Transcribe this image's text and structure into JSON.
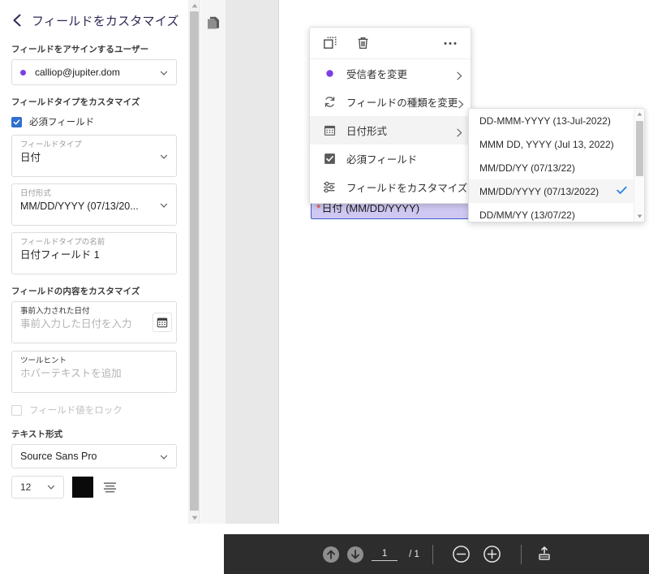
{
  "panel": {
    "title": "フィールドをカスタマイズ",
    "back_icon": "chevron-left-icon",
    "assign_label": "フィールドをアサインするユーザー",
    "assignee_email": "calliop@jupiter.dom",
    "assignee_dot_color": "#7b3fe4",
    "customize_type_label": "フィールドタイプをカスタマイズ",
    "required_checkbox_label": "必須フィールド",
    "required_checked": true,
    "field_type_caption": "フィールドタイプ",
    "field_type_value": "日付",
    "date_format_caption": "日付形式",
    "date_format_value": "MM/DD/YYYY (07/13/20...",
    "field_name_caption": "フィールドタイプの名前",
    "field_name_value": "日付フィールド 1",
    "customize_content_label": "フィールドの内容をカスタマイズ",
    "prefill_caption": "事前入力された日付",
    "prefill_placeholder": "事前入力した日付を入力",
    "prefill_icon": "calendar-icon",
    "tooltip_caption": "ツールヒント",
    "tooltip_placeholder": "ホバーテキストを追加",
    "lock_checkbox_label": "フィールド値をロック",
    "lock_checked": false,
    "text_format_label": "テキスト形式",
    "font_family_value": "Source Sans Pro",
    "font_size_value": "12",
    "font_color": "#0a0a0a",
    "align_icon": "text-align-icon"
  },
  "context_menu": {
    "toolbar_icons": [
      "duplicate-icon",
      "trash-icon",
      "more-icon"
    ],
    "items": [
      {
        "icon": "recipient-dot-icon",
        "label": "受信者を変更",
        "arrow": true,
        "highlight": false
      },
      {
        "icon": "refresh-icon",
        "label": "フィールドの種類を変更",
        "arrow": true,
        "highlight": false
      },
      {
        "icon": "calendar-icon",
        "label": "日付形式",
        "arrow": true,
        "highlight": true
      },
      {
        "icon": "checkbox-checked-icon",
        "label": "必須フィールド",
        "arrow": false,
        "highlight": false
      },
      {
        "icon": "sliders-icon",
        "label": "フィールドをカスタマイズ",
        "arrow": false,
        "highlight": false
      }
    ]
  },
  "submenu": {
    "options": [
      {
        "label": "DD-MMM-YYYY (13-Jul-2022)",
        "selected": false
      },
      {
        "label": "MMM DD, YYYY (Jul 13, 2022)",
        "selected": false
      },
      {
        "label": "MM/DD/YY (07/13/22)",
        "selected": false
      },
      {
        "label": "MM/DD/YYYY (07/13/2022)",
        "selected": true
      },
      {
        "label": "DD/MM/YY (13/07/22)",
        "selected": false
      }
    ],
    "check_color": "#2f86e8"
  },
  "document": {
    "thumbnail_icon": "pages-icon",
    "field": {
      "required_marker": "*",
      "label": "日付 (MM/DD/YYYY)",
      "fill_color": "#cfc8f2",
      "border_color": "#3b5ccc"
    }
  },
  "bottom_toolbar": {
    "prev_page_icon": "arrow-up-circle-icon",
    "next_page_icon": "arrow-down-circle-icon",
    "page_number": "1",
    "page_total": "/ 1",
    "zoom_out_icon": "minus-circle-icon",
    "zoom_in_icon": "plus-circle-icon",
    "fit_icon": "fit-width-icon"
  }
}
